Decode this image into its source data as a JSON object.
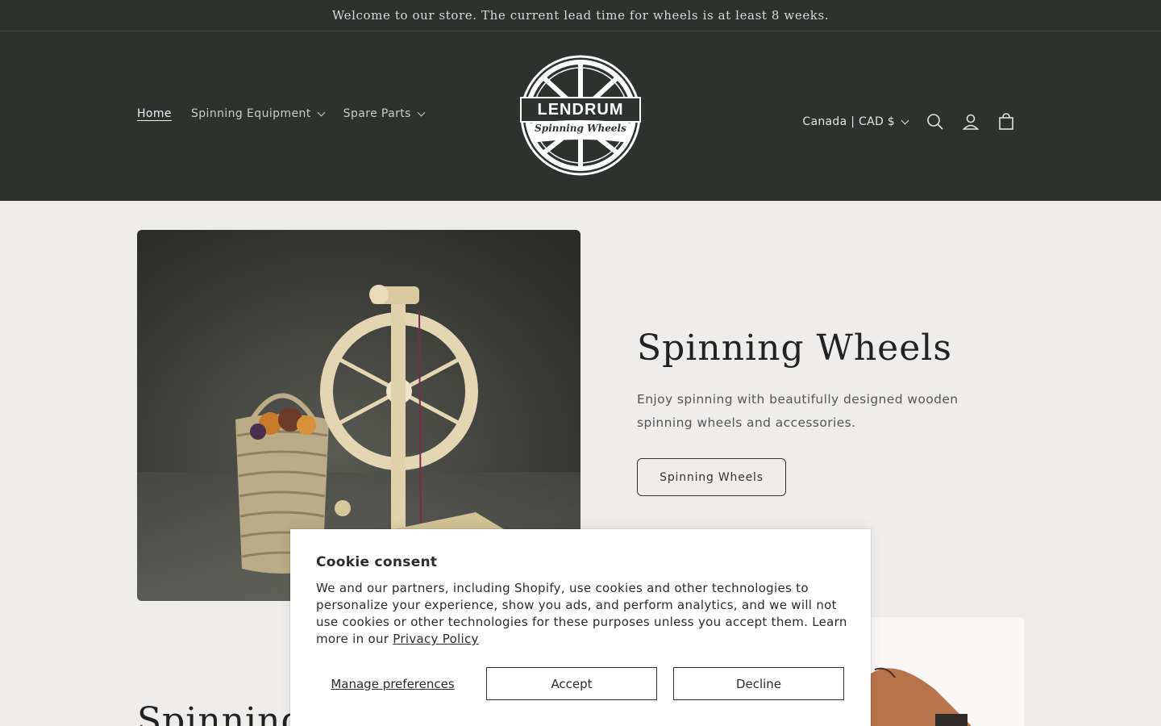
{
  "announcement": "Welcome to our store. The current lead time for wheels is at least 8 weeks.",
  "nav": {
    "home": "Home",
    "spinning_equipment": "Spinning Equipment",
    "spare_parts": "Spare Parts"
  },
  "logo": {
    "word": "LENDRUM",
    "sub": "Spinning Wheels"
  },
  "header_right": {
    "country": "Canada | CAD $",
    "icons": [
      "search-icon",
      "account-icon",
      "cart-icon"
    ]
  },
  "hero": {
    "title": "Spinning Wheels",
    "text": "Enjoy spinning with beautifully designed wooden spinning wheels and accessories.",
    "button": "Spinning Wheels"
  },
  "section2": {
    "title_visible": "Spinning"
  },
  "cookie": {
    "title": "Cookie consent",
    "text": "We and our partners, including Shopify, use cookies and other technologies to personalize your experience, show you ads, and perform analytics, and we will not use cookies or other technologies for these purposes unless you accept them. Learn more in our ",
    "link": "Privacy Policy",
    "manage": "Manage preferences",
    "accept": "Accept",
    "decline": "Decline"
  },
  "colors": {
    "header_bg": "#2d322f",
    "page_bg": "#eeedeb",
    "text_dark": "#222222"
  }
}
